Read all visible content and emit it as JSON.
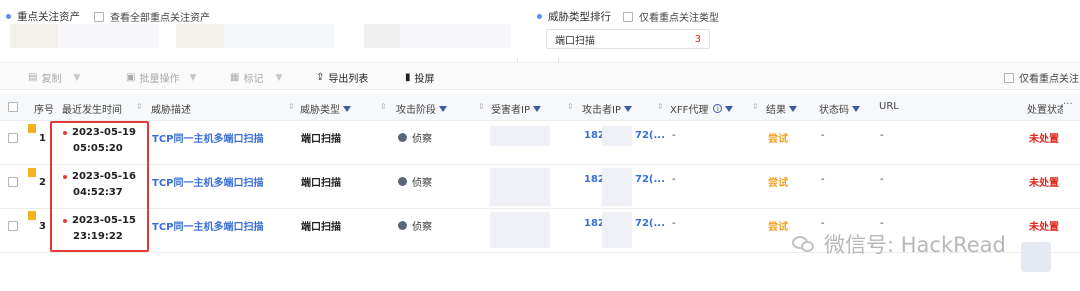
{
  "top": {
    "key_assets_label": "重点关注资产",
    "view_all_label": "查看全部重点关注资产",
    "threat_rank_label": "威胁类型排行",
    "only_key_types_label": "仅看重点关注类型",
    "rank_item_label": "端口扫描",
    "rank_item_count": "3"
  },
  "toolbar": {
    "copy": "复制",
    "batch": "批量操作",
    "mark": "标记",
    "export": "导出列表",
    "screen": "投屏",
    "only_key_focus": "仅看重点关注",
    "collapse": "»"
  },
  "table": {
    "headers": {
      "index": "序号",
      "time": "最近发生时间",
      "desc": "威胁描述",
      "type": "威胁类型",
      "stage": "攻击阶段",
      "victim_ip": "受害者IP",
      "attacker_ip": "攻击者IP",
      "xff": "XFF代理",
      "result": "结果",
      "status_code": "状态码",
      "url": "URL",
      "handle": "处置状态",
      "more": "···"
    },
    "rows": [
      {
        "index": "1",
        "date": "2023-05-19",
        "time": "05:05:20",
        "desc": "TCP同一主机多端口扫描",
        "type": "端口扫描",
        "stage": "侦察",
        "attacker_ip_a": "182.",
        "attacker_ip_b": "72(...",
        "xff": "-",
        "result": "尝试",
        "status_code": "-",
        "url": "-",
        "handle": "未处置"
      },
      {
        "index": "2",
        "date": "2023-05-16",
        "time": "04:52:37",
        "desc": "TCP同一主机多端口扫描",
        "type": "端口扫描",
        "stage": "侦察",
        "attacker_ip_a": "182.",
        "attacker_ip_b": "72(...",
        "xff": "-",
        "result": "尝试",
        "status_code": "-",
        "url": "-",
        "handle": "未处置"
      },
      {
        "index": "3",
        "date": "2023-05-15",
        "time": "23:19:22",
        "desc": "TCP同一主机多端口扫描",
        "type": "端口扫描",
        "stage": "侦察",
        "attacker_ip_a": "182.",
        "attacker_ip_b": "72(...",
        "xff": "-",
        "result": "尝试",
        "status_code": "-",
        "url": "-",
        "handle": "未处置"
      }
    ]
  },
  "watermark": {
    "text": "微信号: HackRead"
  },
  "colors": {
    "accent": "#3a6fd8",
    "warn": "#f0a020",
    "danger": "#e2261b",
    "highlight": "#e53935"
  }
}
